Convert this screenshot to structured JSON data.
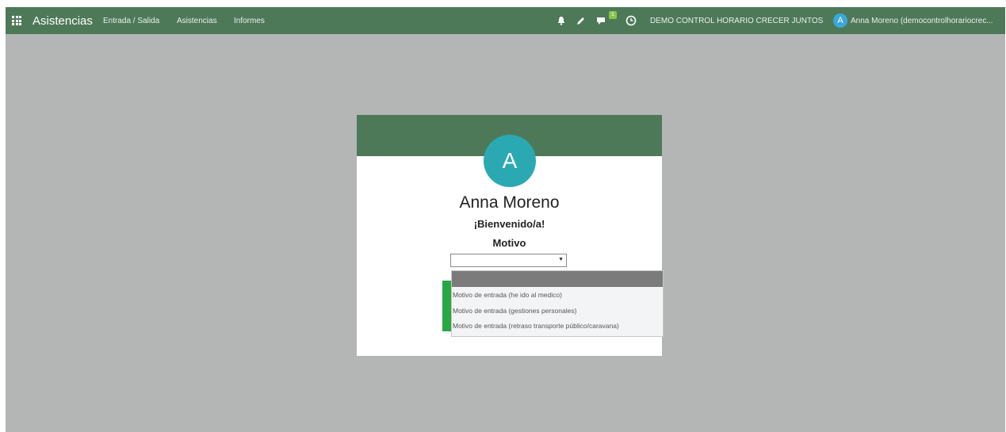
{
  "topbar": {
    "app_title": "Asistencias",
    "menu": [
      "Entrada / Salida",
      "Asistencias",
      "Informes"
    ],
    "notification_badge": "1",
    "company": "DEMO CONTROL HORARIO CRECER JUNTOS",
    "user_initial": "A",
    "user_name": "Anna Moreno (democontrolhorariocrec..."
  },
  "card": {
    "avatar_initial": "A",
    "employee_name": "Anna Moreno",
    "welcome": "¡Bienvenido/a!",
    "motivo_label": "Motivo",
    "select_value": ""
  },
  "dropdown": {
    "options": [
      "",
      "Motivo de entrada (he ido al medico)",
      "Motivo de entrada (gestiones personales)",
      "Motivo de entrada (retraso transporte público/caravana)"
    ]
  },
  "colors": {
    "header_green": "#4d7958",
    "avatar_teal": "#2ba9b3",
    "background": "#b3b6b5",
    "accent_green": "#28a745"
  }
}
